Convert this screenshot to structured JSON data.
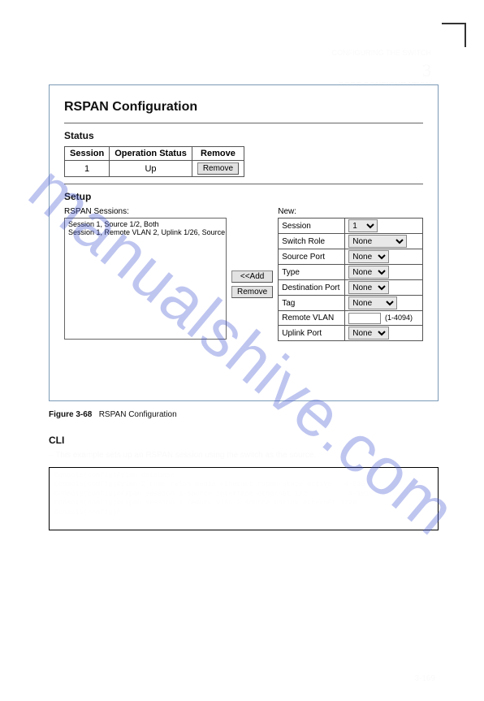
{
  "header": {
    "chapter_title": "CONFIGURING THE SWITCH",
    "section_title": "PORT CONFIGURATION",
    "chapter_num": "3"
  },
  "panel": {
    "title": "RSPAN Configuration",
    "status": {
      "heading": "Status",
      "cols": [
        "Session",
        "Operation Status",
        "Remove"
      ],
      "rows": [
        {
          "session": "1",
          "op_status": "Up",
          "remove_label": "Remove"
        }
      ]
    },
    "setup": {
      "heading": "Setup",
      "sessions_label": "RSPAN Sessions:",
      "sessions_items": [
        "Session 1, Source 1/2, Both",
        "Session 1, Remote VLAN 2, Uplink 1/26, Source"
      ],
      "buttons": {
        "add": "<<Add",
        "remove": "Remove"
      },
      "new_label": "New:",
      "form": {
        "session": {
          "label": "Session",
          "value": "1"
        },
        "switch_role": {
          "label": "Switch Role",
          "value": "None"
        },
        "source_port": {
          "label": "Source Port",
          "value": "None"
        },
        "type": {
          "label": "Type",
          "value": "None"
        },
        "dest_port": {
          "label": "Destination Port",
          "value": "None"
        },
        "tag": {
          "label": "Tag",
          "value": "None"
        },
        "remote_vlan": {
          "label": "Remote VLAN",
          "value": "",
          "hint": "(1-4094)"
        },
        "uplink_port": {
          "label": "Uplink Port",
          "value": "None"
        }
      }
    }
  },
  "caption": {
    "label": "Figure 3-68",
    "text": "RSPAN Configuration"
  },
  "cli": {
    "heading": "CLI",
    "desc": " – This example sets up an RSPAN session using the switch as the source.",
    "lines": [
      "Console(config)#vlan database",
      "Console(config)#vlan 2 name rvlan media ethernet rspan state active   4-239",
      "Console(config)#rspan session 1 source interface ethernet 1/2          4-181",
      "Console(config)#rspan session 1 remote vlan 2 source uplink ethernet 1/26",
      "Console(config)#"
    ]
  },
  "pagenum": "3-169",
  "watermark": "manualshive.com"
}
